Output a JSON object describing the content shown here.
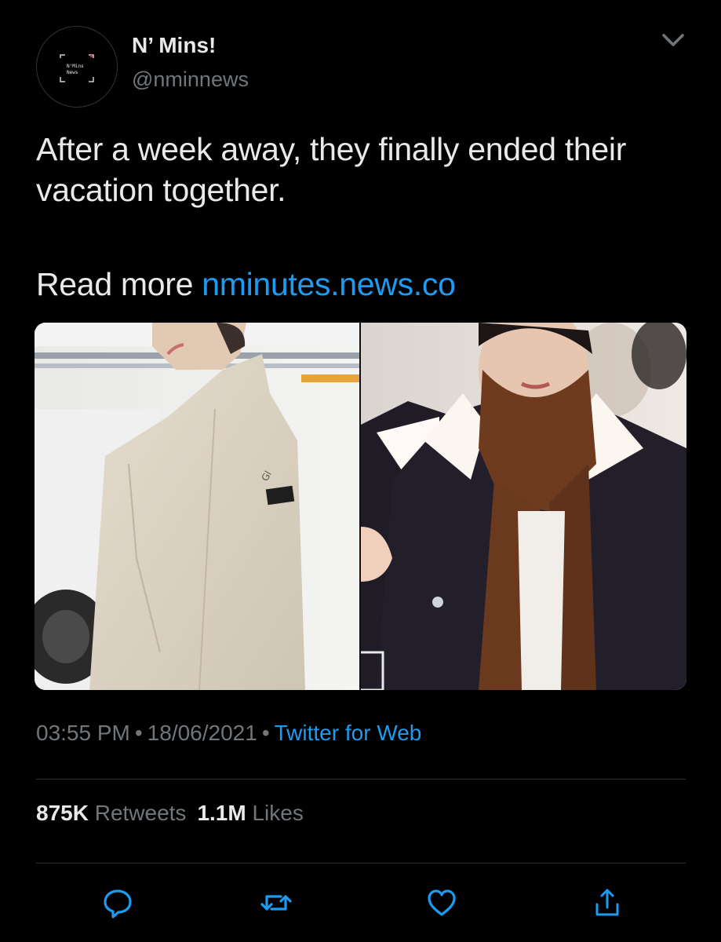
{
  "account": {
    "display_name": "N’ Mins!",
    "handle": "@nminnews",
    "avatar_text_line1": "N'Mins",
    "avatar_text_line2": "News"
  },
  "tweet": {
    "text": "After a week away, they finally ended their vacation together.",
    "read_more_prefix": "Read more ",
    "link_text": "nminutes.news.co"
  },
  "media": {
    "photos": [
      {
        "description_icon": "photo-jacket-beige"
      },
      {
        "description_icon": "photo-scarf-brown"
      }
    ]
  },
  "meta": {
    "time": "03:55 PM",
    "date": "18/06/2021",
    "source": "Twitter for Web",
    "separator": "•"
  },
  "stats": {
    "retweets_count": "875K",
    "retweets_label": "Retweets",
    "likes_count": "1.1M",
    "likes_label": "Likes"
  },
  "actions": {
    "icons": [
      "reply-icon",
      "retweet-icon",
      "like-icon",
      "share-icon"
    ]
  },
  "colors": {
    "background": "#000000",
    "link": "#1d9bf0",
    "text": "#e7e9ea",
    "muted": "#71767b",
    "divider": "#2f3336"
  }
}
